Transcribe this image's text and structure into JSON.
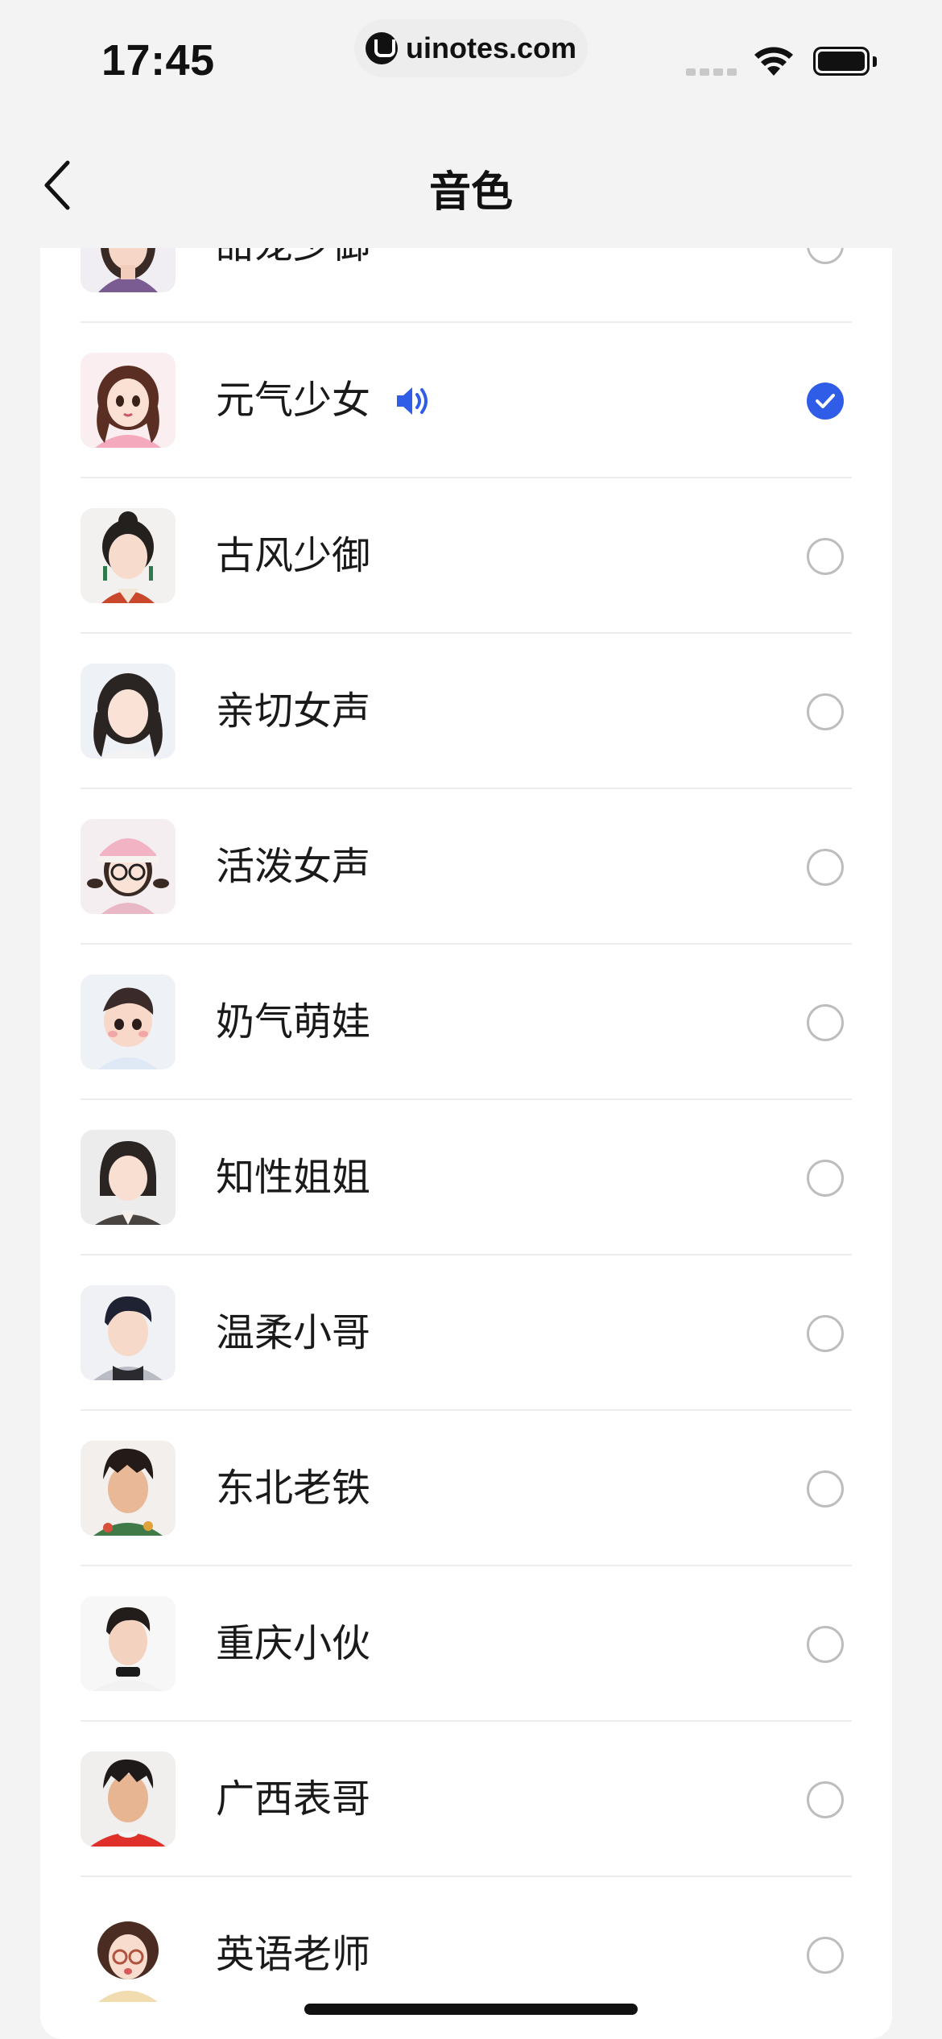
{
  "status_bar": {
    "time": "17:45",
    "url": "uinotes.com",
    "icons": [
      "signal-icon",
      "wifi-icon",
      "battery-icon"
    ]
  },
  "nav": {
    "title": "音色",
    "back_icon": "chevron-left-icon"
  },
  "accent_color": "#2f5de8",
  "voices": [
    {
      "label": "甜宠少御",
      "selected": false,
      "playing": false,
      "avatar": "woman-purple"
    },
    {
      "label": "元气少女",
      "selected": true,
      "playing": true,
      "avatar": "girl-pink"
    },
    {
      "label": "古风少御",
      "selected": false,
      "playing": false,
      "avatar": "woman-ancient"
    },
    {
      "label": "亲切女声",
      "selected": false,
      "playing": false,
      "avatar": "woman-long-hair"
    },
    {
      "label": "活泼女声",
      "selected": false,
      "playing": false,
      "avatar": "girl-cap-glasses"
    },
    {
      "label": "奶气萌娃",
      "selected": false,
      "playing": false,
      "avatar": "boy-child"
    },
    {
      "label": "知性姐姐",
      "selected": false,
      "playing": false,
      "avatar": "woman-bob"
    },
    {
      "label": "温柔小哥",
      "selected": false,
      "playing": false,
      "avatar": "man-hoodie"
    },
    {
      "label": "东北老铁",
      "selected": false,
      "playing": false,
      "avatar": "man-floral"
    },
    {
      "label": "重庆小伙",
      "selected": false,
      "playing": false,
      "avatar": "man-black-collar"
    },
    {
      "label": "广西表哥",
      "selected": false,
      "playing": false,
      "avatar": "man-red-shirt"
    },
    {
      "label": "英语老师",
      "selected": false,
      "playing": false,
      "avatar": "woman-glasses"
    }
  ]
}
